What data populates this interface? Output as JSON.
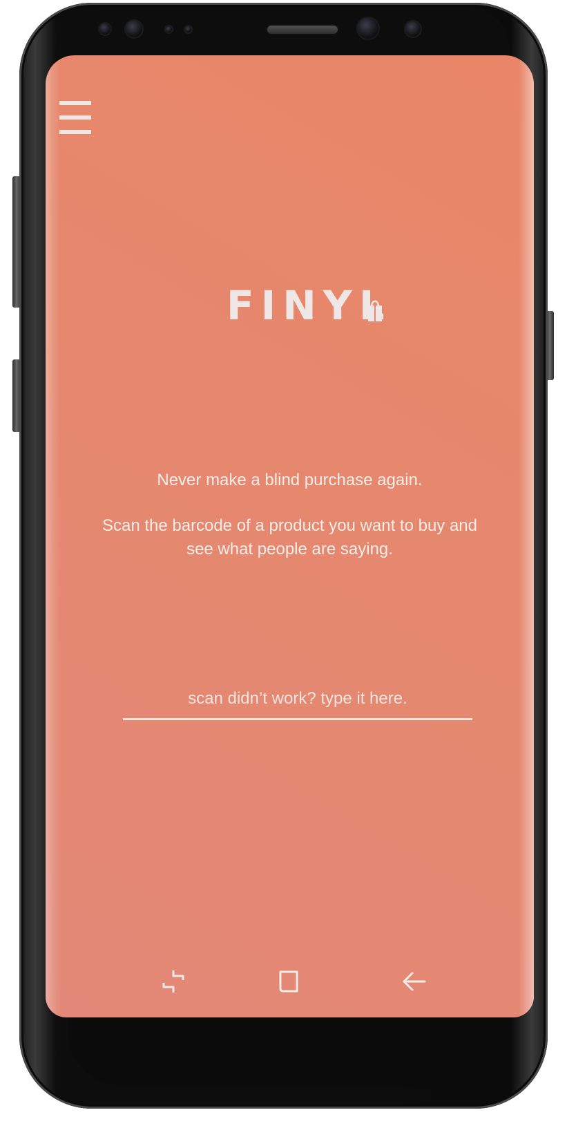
{
  "app": {
    "brand": "FINYL",
    "accent_color": "#e5886f",
    "text_color": "#f6ece8"
  },
  "header": {
    "menu_icon": "hamburger-menu-icon"
  },
  "main": {
    "tagline_primary": "Never make a blind purchase again.",
    "tagline_secondary": "Scan the barcode of a product you want to buy and see what people are saying.",
    "barcode_input": {
      "placeholder": "scan didn’t work? type it here.",
      "value": ""
    }
  },
  "navbar": {
    "recents_icon": "recent-apps-icon",
    "home_icon": "home-square-icon",
    "back_icon": "back-arrow-icon"
  }
}
